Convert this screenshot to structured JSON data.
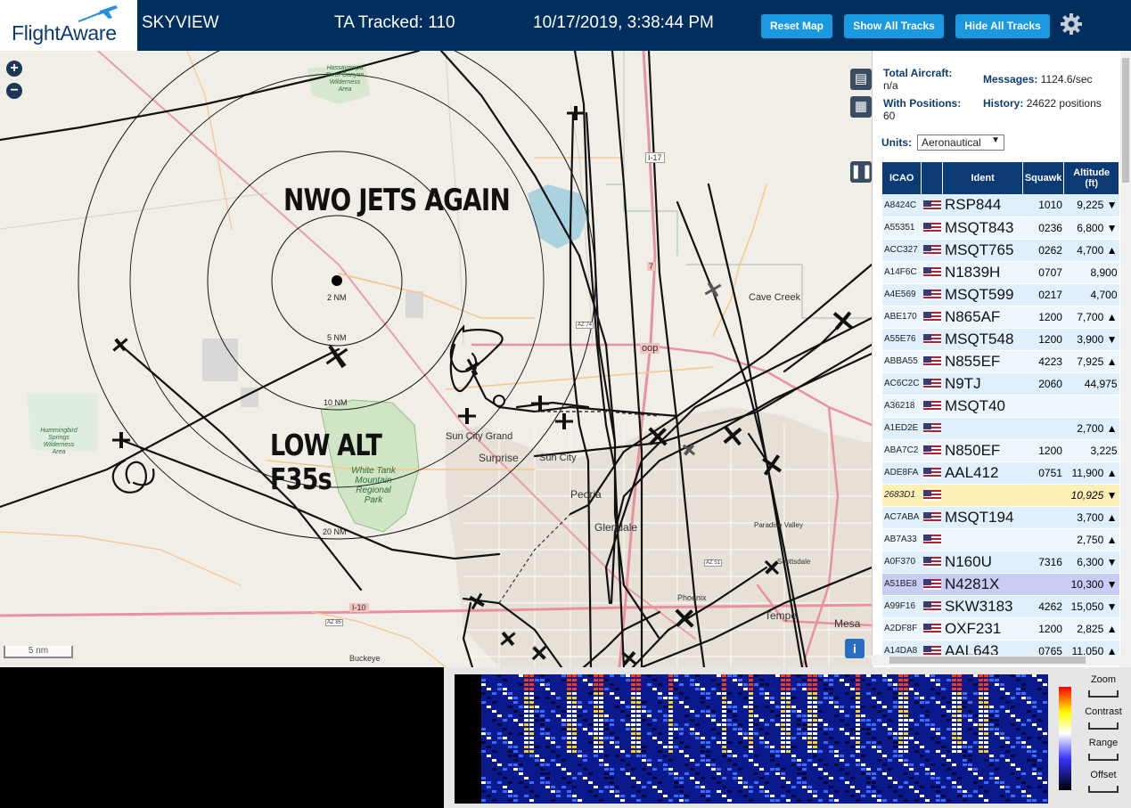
{
  "header": {
    "logo_text": "FlightAware",
    "app_title": "SKYVIEW",
    "ta_tracked": "TA Tracked: 110",
    "datetime": "10/17/2019, 3:38:44 PM",
    "reset_map_label": "Reset Map",
    "show_all_label": "Show All Tracks",
    "hide_all_label": "Hide All Tracks",
    "settings_icon": "gear-icon"
  },
  "map": {
    "zoom_in": "+",
    "zoom_out": "−",
    "scale_label": "5 nm",
    "annotation_top": "NWO JETS AGAIN",
    "annotation_bottom_line1": "LOW ALT",
    "annotation_bottom_line2": "F35s",
    "range_rings": [
      "2 NM",
      "5 NM",
      "10 NM",
      "20 NM"
    ],
    "places": {
      "sun_city_grand": "Sun City Grand",
      "surprise": "Surprise",
      "sun_city": "Sun City",
      "peoria": "Peoria",
      "glendale": "Glendale",
      "phoenix": "Phoenix",
      "tempe": "Tempe",
      "mesa": "Mesa",
      "cave_creek": "Cave Creek",
      "buckeye": "Buckeye",
      "scottsdale": "Scottsdale",
      "paradise_valley": "Paradise Valley"
    },
    "parks": {
      "white_tank": "White Tank Mountain Regional Park",
      "hummingbird": "Hummingbird Springs Wilderness Area",
      "hassayampa": "Hassayampa River Canyon Wilderness Area"
    },
    "road_labels": {
      "i17": "I-17",
      "i10": "I-10",
      "loop": "oop",
      "route7": "7",
      "az74": "AZ 74",
      "az51": "AZ 51",
      "az85": "AZ 85"
    }
  },
  "stats": {
    "total_aircraft_label": "Total Aircraft:",
    "total_aircraft_value": "n/a",
    "with_positions_label": "With Positions:",
    "with_positions_value": "60",
    "messages_label": "Messages:",
    "messages_value": "1124.6/sec",
    "history_label": "History:",
    "history_value": "24622 positions",
    "units_label": "Units:",
    "units_value": "Aeronautical"
  },
  "table": {
    "headers": [
      "ICAO",
      "",
      "Ident",
      "Squawk",
      "Altitude (ft)"
    ],
    "rows": [
      {
        "icao": "A8424C",
        "ident": "RSP844",
        "squawk": "1010",
        "alt": "9,225 ▼"
      },
      {
        "icao": "A55351",
        "ident": "MSQT843",
        "squawk": "0236",
        "alt": "6,800 ▼"
      },
      {
        "icao": "ACC327",
        "ident": "MSQT765",
        "squawk": "0262",
        "alt": "4,700 ▲"
      },
      {
        "icao": "A14F6C",
        "ident": "N1839H",
        "squawk": "0707",
        "alt": "8,900"
      },
      {
        "icao": "A4E569",
        "ident": "MSQT599",
        "squawk": "0217",
        "alt": "4,700"
      },
      {
        "icao": "ABE170",
        "ident": "N865AF",
        "squawk": "1200",
        "alt": "7,700 ▲"
      },
      {
        "icao": "A55E76",
        "ident": "MSQT548",
        "squawk": "1200",
        "alt": "3,900 ▼"
      },
      {
        "icao": "ABBA55",
        "ident": "N855EF",
        "squawk": "4223",
        "alt": "7,925 ▲"
      },
      {
        "icao": "AC6C2C",
        "ident": "N9TJ",
        "squawk": "2060",
        "alt": "44,975"
      },
      {
        "icao": "A36218",
        "ident": "MSQT40",
        "squawk": "",
        "alt": ""
      },
      {
        "icao": "A1ED2E",
        "ident": "",
        "squawk": "",
        "alt": "2,700 ▲"
      },
      {
        "icao": "ABA7C2",
        "ident": "N850EF",
        "squawk": "1200",
        "alt": "3,225"
      },
      {
        "icao": "ADE8FA",
        "ident": "AAL412",
        "squawk": "0751",
        "alt": "11,900 ▲"
      },
      {
        "icao": "2683D1",
        "ident": "",
        "squawk": "",
        "alt": "10,925 ▼"
      },
      {
        "icao": "AC7ABA",
        "ident": "MSQT194",
        "squawk": "",
        "alt": "3,700 ▲"
      },
      {
        "icao": "AB7A33",
        "ident": "",
        "squawk": "",
        "alt": "2,750 ▲"
      },
      {
        "icao": "A0F370",
        "ident": "N160U",
        "squawk": "7316",
        "alt": "6,300 ▼"
      },
      {
        "icao": "A51BE8",
        "ident": "N4281X",
        "squawk": "",
        "alt": "10,300 ▼"
      },
      {
        "icao": "A99F16",
        "ident": "SKW3183",
        "squawk": "4262",
        "alt": "15,050 ▼"
      },
      {
        "icao": "A2DF8F",
        "ident": "OXF231",
        "squawk": "1200",
        "alt": "2,825 ▲"
      },
      {
        "icao": "A14DA8",
        "ident": "AAL643",
        "squawk": "0765",
        "alt": "11,050 ▲"
      }
    ]
  },
  "waterfall": {
    "zoom_label": "Zoom",
    "contrast_label": "Contrast",
    "range_label": "Range",
    "offset_label": "Offset"
  },
  "colors": {
    "header_bg": "#002f5d",
    "button_bg": "#1a98e0",
    "table_header_bg": "#0b3a74"
  }
}
